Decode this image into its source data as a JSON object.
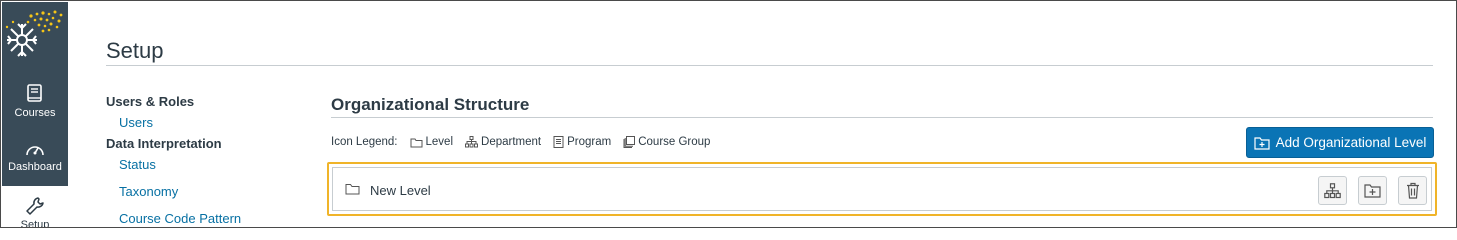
{
  "nav": {
    "items": [
      {
        "label": "Courses",
        "icon": "book-icon"
      },
      {
        "label": "Dashboard",
        "icon": "gauge-icon"
      },
      {
        "label": "Setup",
        "icon": "wrench-icon"
      }
    ],
    "colors": {
      "background": "#394b58",
      "logo_accent": "#f5c518"
    }
  },
  "page": {
    "title": "Setup"
  },
  "sidebar": {
    "sections": [
      {
        "heading": "Users & Roles",
        "links": [
          "Users"
        ]
      },
      {
        "heading": "Data Interpretation",
        "links": [
          "Status",
          "Taxonomy",
          "Course Code Pattern"
        ]
      }
    ]
  },
  "main": {
    "title": "Organizational Structure",
    "legend": {
      "label": "Icon Legend:",
      "items": [
        "Level",
        "Department",
        "Program",
        "Course Group"
      ]
    },
    "add_button": "Add Organizational Level",
    "levels": [
      {
        "name": "New Level"
      }
    ],
    "colors": {
      "primary": "#0a74b5",
      "highlight": "#f0b429",
      "link": "#0770a3"
    }
  }
}
